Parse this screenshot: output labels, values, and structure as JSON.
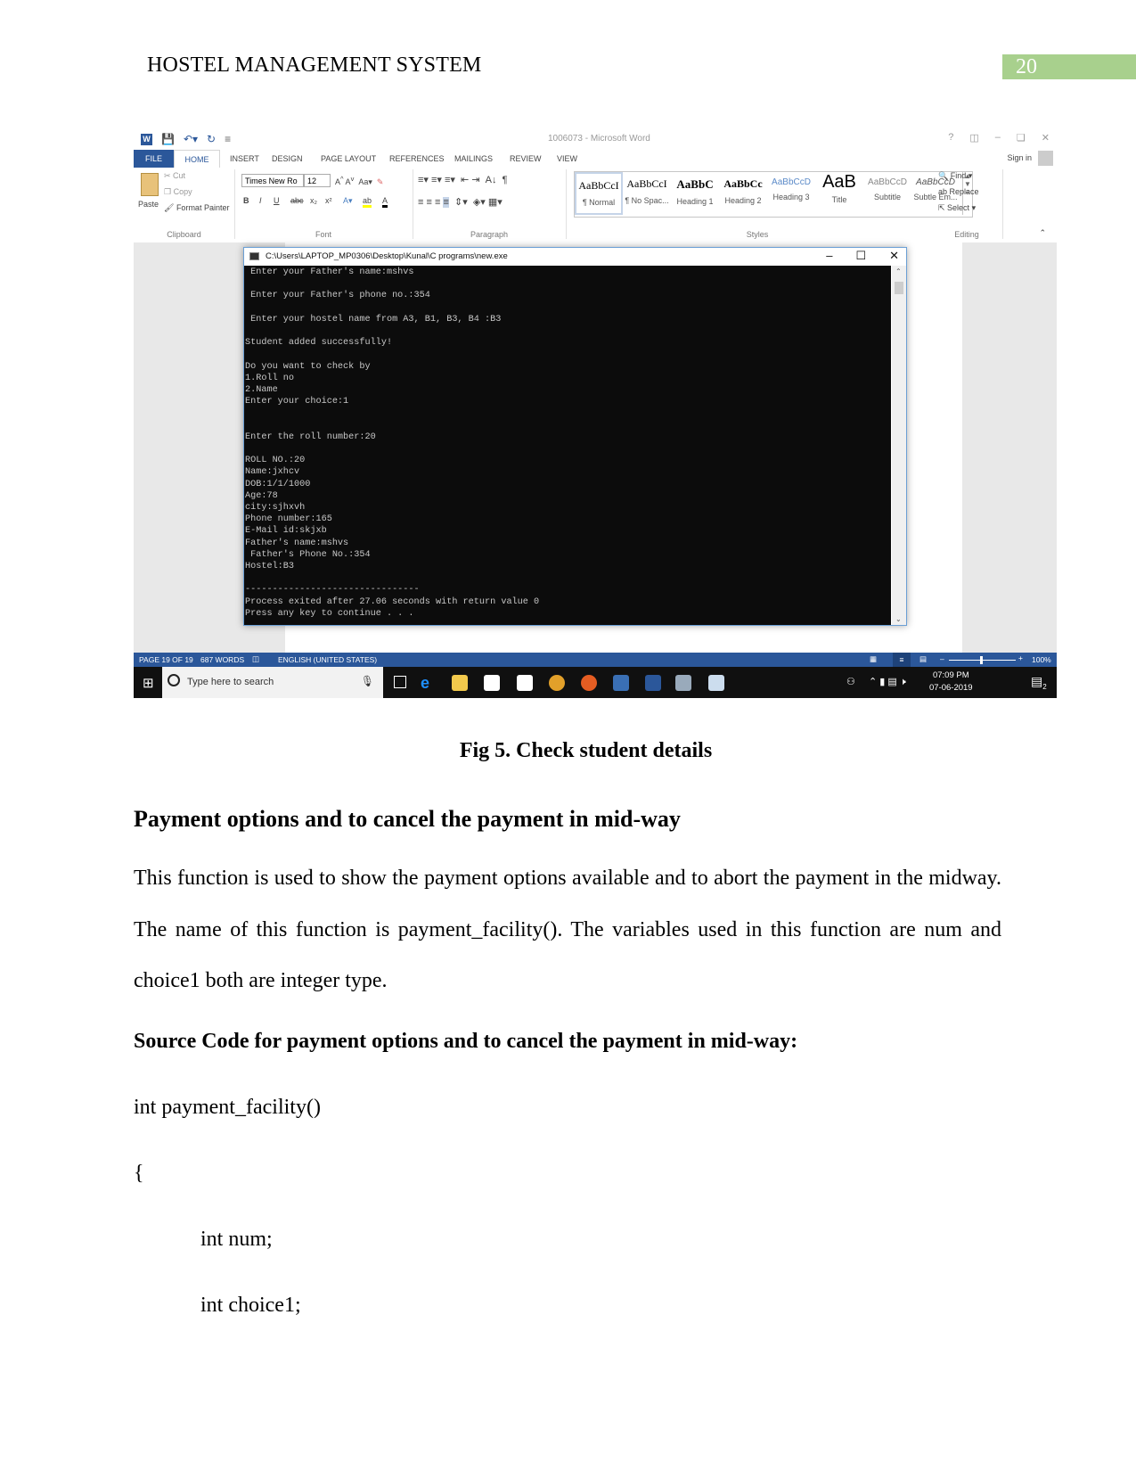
{
  "header": {
    "title": "HOSTEL MANAGEMENT SYSTEM",
    "page_number": "20",
    "page_number_bg": "#a8d08d"
  },
  "screenshot": {
    "word": {
      "window_title": "1006073 - Microsoft Word",
      "window_controls": [
        "?",
        "ribbon-display-options",
        "minimize",
        "restore",
        "close"
      ],
      "sign_in": "Sign in",
      "tabs": [
        "FILE",
        "HOME",
        "INSERT",
        "DESIGN",
        "PAGE LAYOUT",
        "REFERENCES",
        "MAILINGS",
        "REVIEW",
        "VIEW"
      ],
      "active_tab": "HOME",
      "clipboard": {
        "paste": "Paste",
        "cut": "Cut",
        "copy": "Copy",
        "format_painter": "Format Painter",
        "label": "Clipboard"
      },
      "font": {
        "name": "Times New Ro",
        "size": "12",
        "label": "Font",
        "buttons": [
          "B",
          "I",
          "U",
          "abc",
          "x₂",
          "x²"
        ]
      },
      "paragraph": {
        "label": "Paragraph"
      },
      "styles": {
        "label": "Styles",
        "items": [
          {
            "preview": "AaBbCcI",
            "name": "¶ Normal"
          },
          {
            "preview": "AaBbCcI",
            "name": "¶ No Spac..."
          },
          {
            "preview": "AaBbC",
            "name": "Heading 1"
          },
          {
            "preview": "AaBbCc",
            "name": "Heading 2"
          },
          {
            "preview": "AaBbCcD",
            "name": "Heading 3"
          },
          {
            "preview": "AaB",
            "name": "Title"
          },
          {
            "preview": "AaBbCcD",
            "name": "Subtitle"
          },
          {
            "preview": "AaBbCcD",
            "name": "Subtle Em..."
          }
        ]
      },
      "editing": {
        "find": "Find",
        "replace": "Replace",
        "select": "Select",
        "label": "Editing"
      },
      "status": {
        "page": "PAGE 19 OF 19",
        "words": "687 WORDS",
        "language": "ENGLISH (UNITED STATES)",
        "zoom": "100%"
      },
      "accent": "#2b579a"
    },
    "console": {
      "title": "C:\\Users\\LAPTOP_MP0306\\Desktop\\Kunal\\C programs\\new.exe",
      "lines": [
        " Enter your Father's name:mshvs",
        "",
        " Enter your Father's phone no.:354",
        "",
        " Enter your hostel name from A3, B1, B3, B4 :B3",
        "",
        "Student added successfully!",
        "",
        "Do you want to check by",
        "1.Roll no",
        "2.Name",
        "Enter your choice:1",
        "",
        "",
        "Enter the roll number:20",
        "",
        "ROLL NO.:20",
        "Name:jxhcv",
        "DOB:1/1/1000",
        "Age:78",
        "city:sjhxvh",
        "Phone number:165",
        "E-Mail id:skjxb",
        "Father's name:mshvs",
        " Father's Phone No.:354",
        "Hostel:B3",
        "",
        "--------------------------------",
        "Process exited after 27.06 seconds with return value 0",
        "Press any key to continue . . ."
      ]
    },
    "taskbar": {
      "search_placeholder": "Type here to search",
      "time": "07:09 PM",
      "date": "07-06-2019",
      "notifications": "2"
    }
  },
  "caption": "Fig 5. Check student details",
  "section": {
    "heading": "Payment options and to cancel the payment in mid-way",
    "paragraph": "This function is used to show the payment options available and to abort the payment in the midway. The name of this function is payment_facility(). The variables used in this function are num and choice1 both are integer type.",
    "source_heading": "Source Code for payment options and to cancel the payment in mid-way:",
    "code_lines": [
      "int payment_facility()",
      "{",
      "int num;",
      "int choice1;"
    ]
  }
}
